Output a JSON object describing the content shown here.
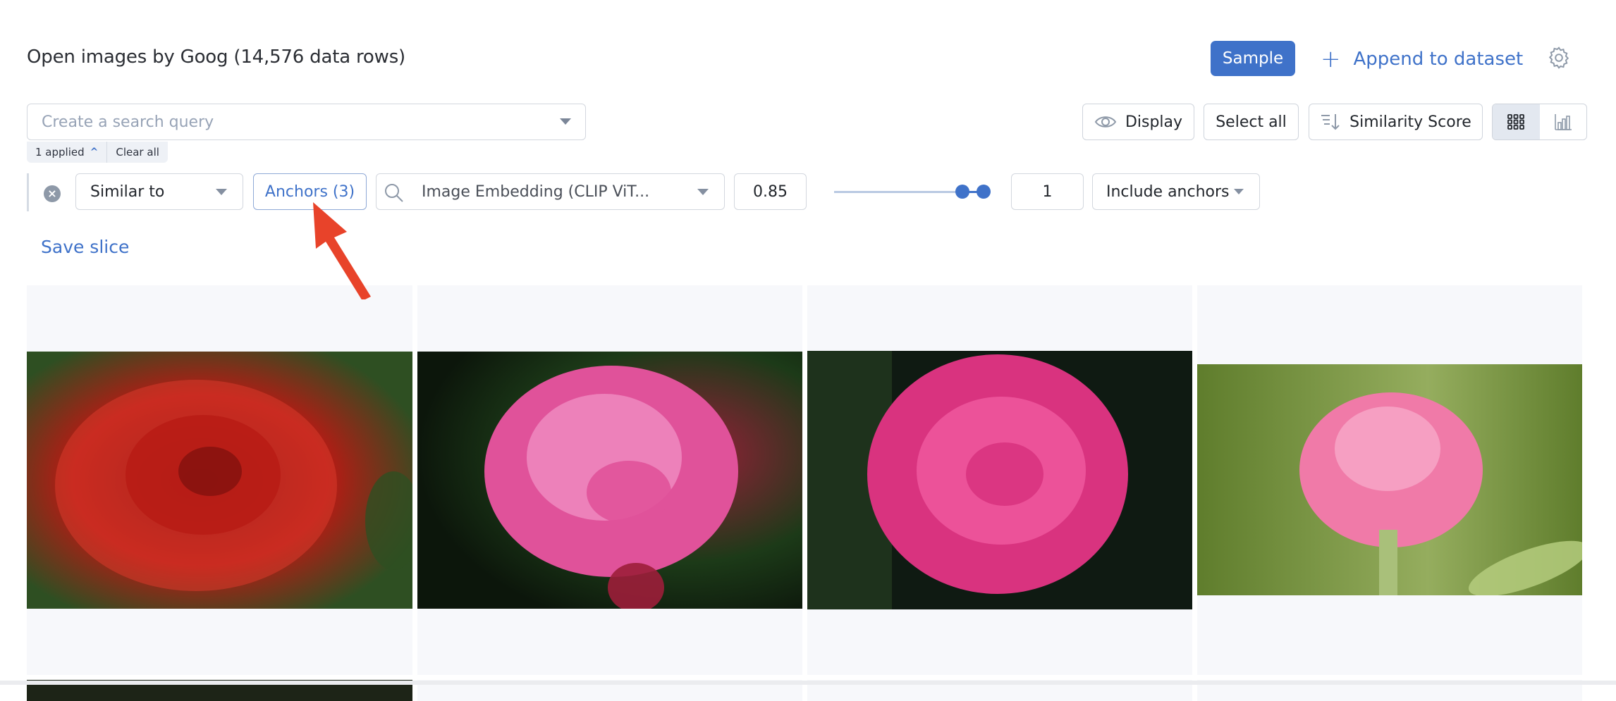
{
  "header": {
    "title": "Open images by Goog (14,576 data rows)",
    "sample_label": "Sample",
    "append_label": "Append to dataset",
    "append_icon": "plus-icon",
    "settings_icon": "gear-icon"
  },
  "search": {
    "placeholder": "Create a search query",
    "applied_label": "1 applied",
    "clear_all_label": "Clear all"
  },
  "toolbar": {
    "display_label": "Display",
    "select_all_label": "Select all",
    "sort_label": "Similarity Score",
    "view_modes": [
      {
        "name": "grid",
        "icon": "grid-icon",
        "active": true
      },
      {
        "name": "chart",
        "icon": "bar-chart-icon",
        "active": false
      }
    ]
  },
  "filter": {
    "operator": "Similar to",
    "anchors_label": "Anchors (3)",
    "embedding": "Image Embedding (CLIP ViT...",
    "threshold": "0.85",
    "slider_range": [
      0.85,
      1.0
    ],
    "top_k": "1",
    "include_option": "Include anchors"
  },
  "save_slice_label": "Save slice",
  "annotation": {
    "arrow_color": "#e8432a",
    "target": "Anchors (3)"
  },
  "colors": {
    "accent": "#3f72c9",
    "card_bg": "#f7f8fb"
  },
  "gallery": [
    {
      "description": "red rose",
      "palette": [
        "#b81a14",
        "#d93a2c",
        "#2e4f22",
        "#7a0f0d"
      ]
    },
    {
      "description": "pink rose on dark green",
      "palette": [
        "#e0529a",
        "#f08dc2",
        "#1c3a18",
        "#9c1e3a"
      ]
    },
    {
      "description": "magenta rose with foliage",
      "palette": [
        "#d9337f",
        "#f05aa0",
        "#0f1a12",
        "#2d4a25"
      ]
    },
    {
      "description": "light pink rose bud",
      "palette": [
        "#f07aa8",
        "#f8a9c8",
        "#5f7d2c",
        "#95ad5e"
      ]
    }
  ]
}
